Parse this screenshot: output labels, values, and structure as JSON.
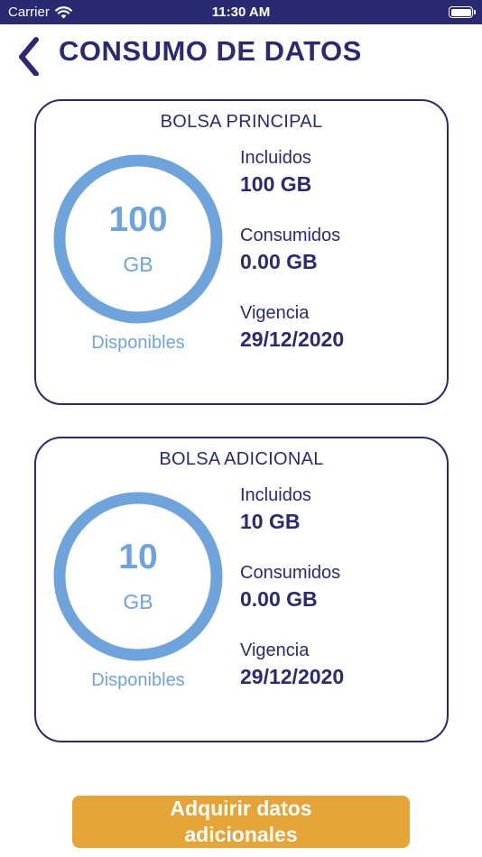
{
  "status_bar": {
    "carrier": "Carrier",
    "time": "11:30 AM"
  },
  "header": {
    "title": "CONSUMO DE DATOS"
  },
  "cards": [
    {
      "title": "BOLSA PRINCIPAL",
      "ring_value": "100",
      "ring_unit": "GB",
      "ring_caption": "Disponibles",
      "included_label": "Incluidos",
      "included_value": "100 GB",
      "consumed_label": "Consumidos",
      "consumed_value": "0.00 GB",
      "validity_label": "Vigencia",
      "validity_value": "29/12/2020"
    },
    {
      "title": "BOLSA ADICIONAL",
      "ring_value": "10",
      "ring_unit": "GB",
      "ring_caption": "Disponibles",
      "included_label": "Incluidos",
      "included_value": "10 GB",
      "consumed_label": "Consumidos",
      "consumed_value": "0.00 GB",
      "validity_label": "Vigencia",
      "validity_value": "29/12/2020"
    }
  ],
  "cta": {
    "label_line1": "Adquirir datos",
    "label_line2": "adicionales"
  },
  "colors": {
    "primary": "#2a2a72",
    "ring": "#6fa3dc",
    "cta": "#e6a336"
  },
  "icons": {
    "back": "chevron-left-icon",
    "wifi": "wifi-icon",
    "battery": "battery-icon"
  }
}
